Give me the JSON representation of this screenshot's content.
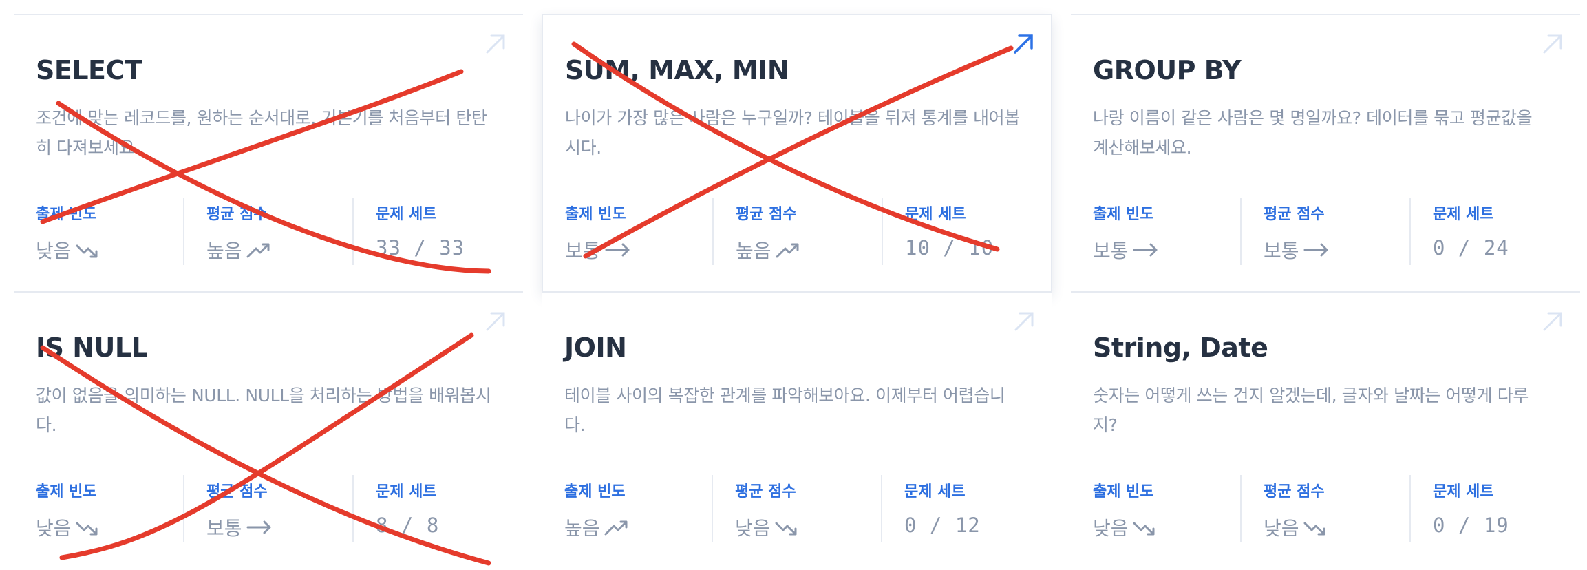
{
  "stat_labels": {
    "frequency": "출제 빈도",
    "average": "평균 점수",
    "sets": "문제 세트"
  },
  "cards": [
    {
      "title": "SELECT",
      "description": "조건에 맞는 레코드를, 원하는 순서대로. 기본기를 처음부터 탄탄히 다져보세요.",
      "frequency": {
        "text": "낮음",
        "icon": "trend-down-icon"
      },
      "average": {
        "text": "높음",
        "icon": "trend-up-icon"
      },
      "sets": "33 / 33",
      "crossed_out": true,
      "active": false
    },
    {
      "title": "SUM, MAX, MIN",
      "description": "나이가 가장 많은 사람은 누구일까? 테이블을 뒤져 통계를 내어봅시다.",
      "frequency": {
        "text": "보통",
        "icon": "arrow-right-icon"
      },
      "average": {
        "text": "높음",
        "icon": "trend-up-icon"
      },
      "sets": "10 / 10",
      "crossed_out": true,
      "active": true
    },
    {
      "title": "GROUP BY",
      "description": "나랑 이름이 같은 사람은 몇 명일까요? 데이터를 묶고 평균값을 계산해보세요.",
      "frequency": {
        "text": "보통",
        "icon": "arrow-right-icon"
      },
      "average": {
        "text": "보통",
        "icon": "arrow-right-icon"
      },
      "sets": "0 / 24",
      "crossed_out": false,
      "active": false
    },
    {
      "title": "IS NULL",
      "description": "값이 없음을 의미하는 NULL. NULL을 처리하는 방법을 배워봅시다.",
      "frequency": {
        "text": "낮음",
        "icon": "trend-down-icon"
      },
      "average": {
        "text": "보통",
        "icon": "arrow-right-icon"
      },
      "sets": "8 / 8",
      "crossed_out": true,
      "active": false
    },
    {
      "title": "JOIN",
      "description": "테이블 사이의 복잡한 관계를 파악해보아요. 이제부터 어렵습니다.",
      "frequency": {
        "text": "높음",
        "icon": "trend-up-icon"
      },
      "average": {
        "text": "낮음",
        "icon": "trend-down-icon"
      },
      "sets": "0 / 12",
      "crossed_out": false,
      "active": false
    },
    {
      "title": "String, Date",
      "description": "숫자는 어떻게 쓰는 건지 알겠는데, 글자와 날짜는 어떻게 다루지?",
      "frequency": {
        "text": "낮음",
        "icon": "trend-down-icon"
      },
      "average": {
        "text": "낮음",
        "icon": "trend-down-icon"
      },
      "sets": "0 / 19",
      "crossed_out": false,
      "active": false
    }
  ],
  "colors": {
    "accent": "#2d6fe0",
    "title": "#263142",
    "muted": "#8a96aa",
    "divider": "#e6eaf1",
    "strike": "#e53b2c",
    "arrow_inactive": "#dbe4f3",
    "arrow_active": "#2d72e6"
  }
}
